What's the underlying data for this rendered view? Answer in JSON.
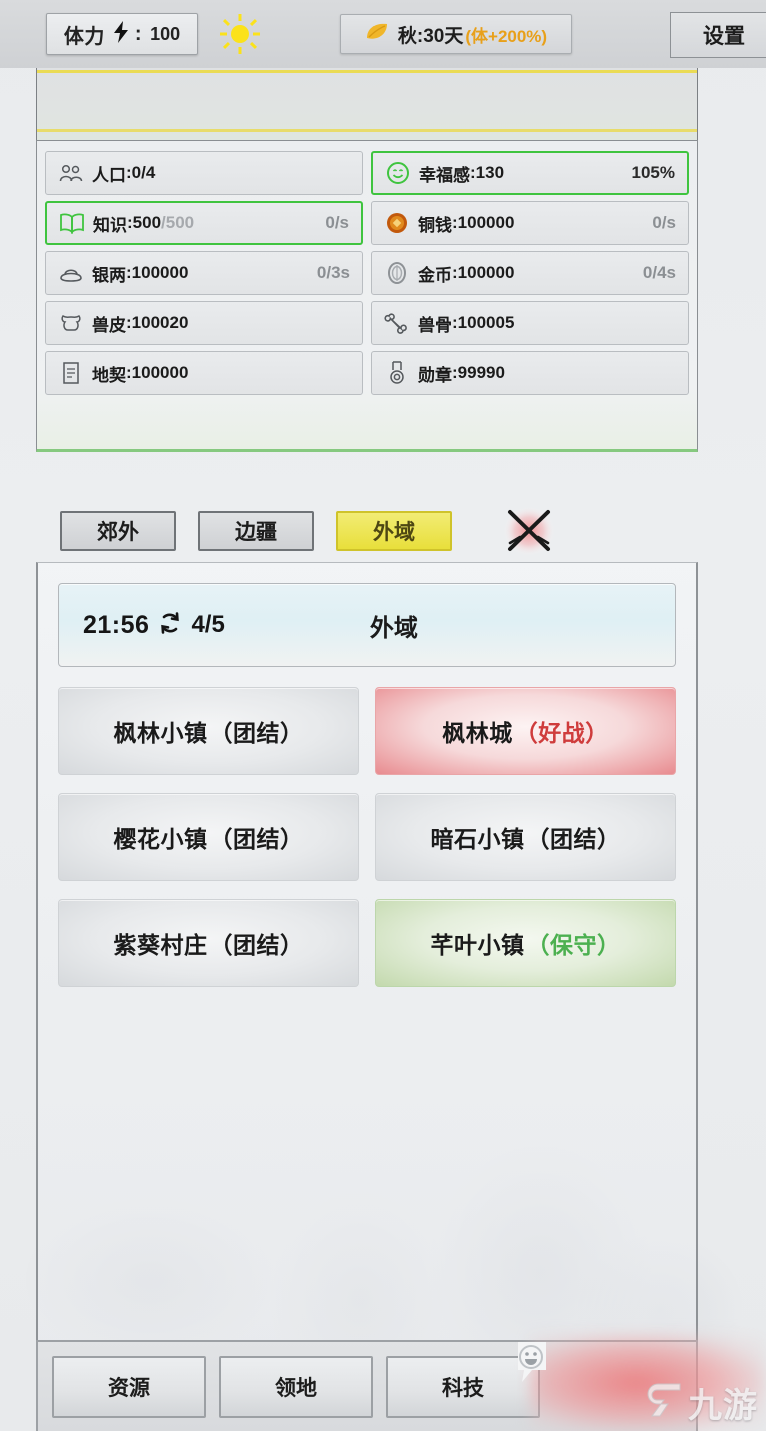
{
  "topbar": {
    "stamina_label": "体力",
    "stamina_sep": ":",
    "stamina_value": "100",
    "bolt_icon": "lightning-bolt-icon",
    "sun_icon": "sun-icon",
    "leaf_icon": "leaf-icon",
    "season_text": "秋:30天",
    "season_bonus": "(体+200%)",
    "settings_label": "设置"
  },
  "resources": {
    "rows": [
      {
        "icon": "population-icon",
        "name": "人口",
        "sep": ":",
        "value": "0/4",
        "max": "",
        "rate": "",
        "highlight": false
      },
      {
        "icon": "happiness-face-icon",
        "name": "幸福感",
        "sep": ":",
        "value": "130",
        "max": "",
        "rate": "105%",
        "highlight": true
      },
      {
        "icon": "book-icon",
        "name": "知识",
        "sep": ":",
        "value": "500",
        "max": "/500",
        "rate": "0/s",
        "highlight": true
      },
      {
        "icon": "copper-coin-icon",
        "name": "铜钱",
        "sep": ":",
        "value": "100000",
        "max": "",
        "rate": "0/s",
        "highlight": false
      },
      {
        "icon": "silver-ingot-icon",
        "name": "银两",
        "sep": ":",
        "value": "100000",
        "max": "",
        "rate": "0/3s",
        "highlight": false
      },
      {
        "icon": "gold-coin-icon",
        "name": "金币",
        "sep": ":",
        "value": "100000",
        "max": "",
        "rate": "0/4s",
        "highlight": false
      },
      {
        "icon": "beast-hide-icon",
        "name": "兽皮",
        "sep": ":",
        "value": "100020",
        "max": "",
        "rate": "",
        "highlight": false
      },
      {
        "icon": "bone-icon",
        "name": "兽骨",
        "sep": ":",
        "value": "100005",
        "max": "",
        "rate": "",
        "highlight": false
      },
      {
        "icon": "land-deed-icon",
        "name": "地契",
        "sep": ":",
        "value": "100000",
        "max": "",
        "rate": "",
        "highlight": false
      },
      {
        "icon": "medal-icon",
        "name": "勋章",
        "sep": ":",
        "value": "99990",
        "max": "",
        "rate": "",
        "highlight": false
      }
    ]
  },
  "tabs": {
    "items": [
      {
        "label": "郊外",
        "active": false
      },
      {
        "label": "边疆",
        "active": false
      },
      {
        "label": "外域",
        "active": true
      }
    ],
    "battle_icon": "crossed-swords-icon"
  },
  "timer": {
    "clock": "21:56",
    "refresh_icon": "refresh-icon",
    "count": "4/5",
    "region": "外域"
  },
  "locations": [
    {
      "name": "枫林小镇",
      "tag": "（团结）",
      "state": "neutral"
    },
    {
      "name": "枫林城",
      "tag": "（好战）",
      "state": "war"
    },
    {
      "name": "樱花小镇",
      "tag": "（团结）",
      "state": "neutral"
    },
    {
      "name": "暗石小镇",
      "tag": "（团结）",
      "state": "neutral"
    },
    {
      "name": "紫葵村庄",
      "tag": "（团结）",
      "state": "neutral"
    },
    {
      "name": "芊叶小镇",
      "tag": "（保守）",
      "state": "peace"
    }
  ],
  "bottom_nav": {
    "items": [
      {
        "label": "资源"
      },
      {
        "label": "领地"
      },
      {
        "label": "科技"
      }
    ]
  },
  "overlay": {
    "chat_icon": "smiley-chat-icon",
    "watermark_text": "九游"
  },
  "colors": {
    "accent_yellow": "#e8df3b",
    "highlight_green": "#3fc43f",
    "war_red": "#cf3c3c",
    "peace_green": "#4cb050",
    "season_orange": "#e8a01a",
    "panel_bg": "#eceef0"
  }
}
